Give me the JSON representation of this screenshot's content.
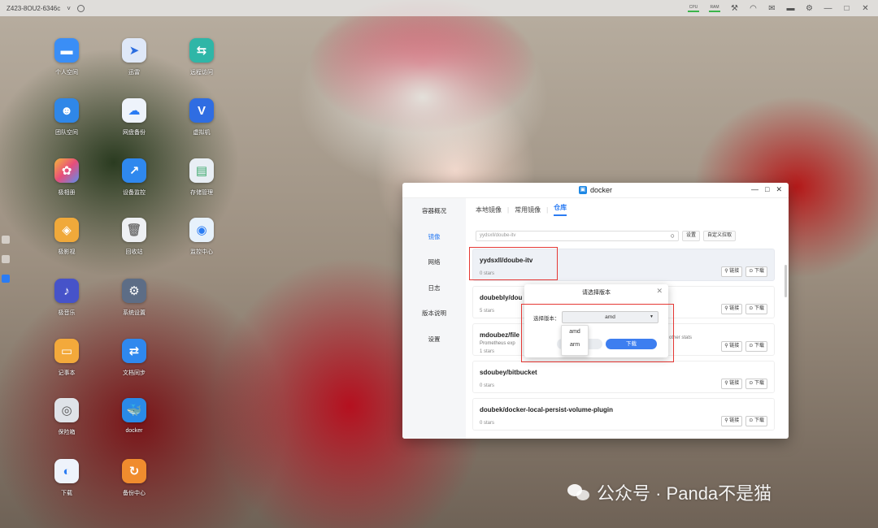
{
  "topbar": {
    "hostname": "Z423-8OU2-6346c",
    "cpu_label": "CPU",
    "ram_label": "RAM"
  },
  "desktop": {
    "icons": [
      {
        "label": "个人空间",
        "color": "#3a8ef6",
        "glyph": "folder-icon"
      },
      {
        "label": "迅雷",
        "color": "#dfe8f8",
        "glyph": "bird-icon"
      },
      {
        "label": "远程访问",
        "color": "#2fb6a7",
        "glyph": "remote-icon"
      },
      {
        "label": "团队空间",
        "color": "#2f87e8",
        "glyph": "team-folder-icon"
      },
      {
        "label": "网盘备份",
        "color": "#eef3fb",
        "glyph": "cloud-backup-icon"
      },
      {
        "label": "虚拟机",
        "color": "#2f6de2",
        "glyph": "vm-icon"
      },
      {
        "label": "极相册",
        "color": "#f08c3b",
        "glyph": "photos-icon"
      },
      {
        "label": "设备监控",
        "color": "#2f88ee",
        "glyph": "monitor-chart-icon"
      },
      {
        "label": "存储管理",
        "color": "#e8eef4",
        "glyph": "storage-icon"
      },
      {
        "label": "极影视",
        "color": "#f0a93a",
        "glyph": "video-icon"
      },
      {
        "label": "回收站",
        "color": "#eef0f3",
        "glyph": "trash-icon"
      },
      {
        "label": "监控中心",
        "color": "#e7f1fb",
        "glyph": "camera-icon"
      },
      {
        "label": "极音乐",
        "color": "#4653c9",
        "glyph": "music-icon"
      },
      {
        "label": "系统设置",
        "color": "#5d6d86",
        "glyph": "settings-icon"
      },
      {
        "label": "记事本",
        "color": "#f3a93b",
        "glyph": "notepad-icon"
      },
      {
        "label": "文档同步",
        "color": "#2f88ee",
        "glyph": "sync-icon"
      },
      {
        "label": "保险箱",
        "color": "#dfe3e8",
        "glyph": "safe-icon"
      },
      {
        "label": "docker",
        "color": "#2a8ae8",
        "glyph": "docker-icon"
      },
      {
        "label": "下载",
        "color": "#eef3fb",
        "glyph": "download-globe-icon"
      },
      {
        "label": "备份中心",
        "color": "#f08c2e",
        "glyph": "backup-icon"
      }
    ]
  },
  "docker": {
    "title": "docker",
    "sidebar": [
      "容器概况",
      "镜像",
      "网络",
      "日志",
      "版本说明",
      "设置"
    ],
    "tabs": [
      "本地镜像",
      "常用镜像",
      "仓库"
    ],
    "search": {
      "value": "yydsxll/doube-itv",
      "settings_btn": "设置",
      "custom_pull_btn": "自定义拉取"
    },
    "results": [
      {
        "name": "yydsxll/doube-itv",
        "desc": "",
        "stars": "0 stars"
      },
      {
        "name": "doubebly/dou",
        "desc": "",
        "stars": "5 stars"
      },
      {
        "name": "mdoubez/file",
        "desc": "Prometheus exp",
        "stars": "1 stars"
      },
      {
        "name": "sdoubey/bitbucket",
        "desc": "",
        "stars": "0 stars"
      },
      {
        "name": "doubek/docker-local-persist-volume-plugin",
        "desc": "",
        "stars": "0 stars"
      }
    ],
    "link_btn": "链接",
    "download_btn": "下载",
    "desc_tail": "other stats"
  },
  "dialog": {
    "title": "请选择版本",
    "field_label": "选择版本：",
    "selected": "amd",
    "options": [
      "amd",
      "arm"
    ],
    "ok_label": "下载"
  },
  "watermark": {
    "text": "公众号 · Panda不是猫"
  }
}
